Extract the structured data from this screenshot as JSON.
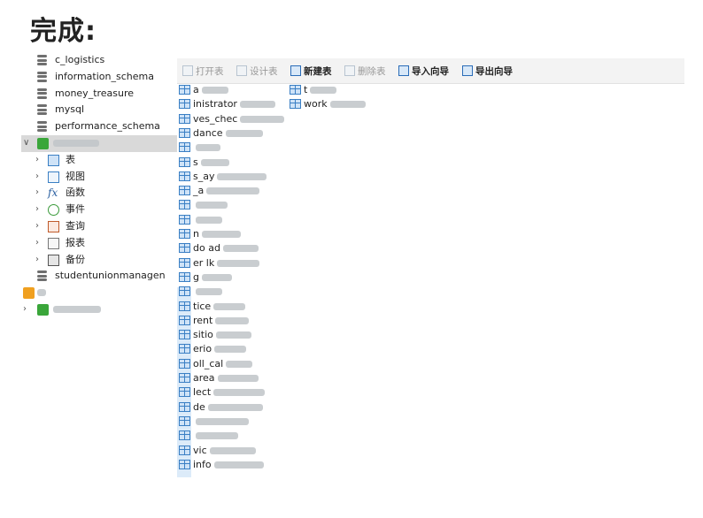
{
  "heading": "完成:",
  "sidebar": {
    "databases_above": [
      "c_logistics",
      "information_schema",
      "money_treasure",
      "mysql",
      "performance_schema"
    ],
    "children": [
      {
        "label": "表",
        "icon": "table-icon"
      },
      {
        "label": "视图",
        "icon": "view-icon"
      },
      {
        "label": "函数",
        "icon": "function-icon"
      },
      {
        "label": "事件",
        "icon": "event-icon"
      },
      {
        "label": "查询",
        "icon": "query-icon"
      },
      {
        "label": "报表",
        "icon": "report-icon"
      },
      {
        "label": "备份",
        "icon": "backup-icon"
      }
    ],
    "database_below": "studentunionmanagen"
  },
  "toolbar": {
    "open": "打开表",
    "design": "设计表",
    "new": "新建表",
    "delete": "删除表",
    "import": "导入向导",
    "export": "导出向导"
  },
  "tables_col1": [
    "a",
    "inistrator",
    "ves_chec",
    "dance",
    "",
    "s",
    "s_ay",
    "_a",
    "",
    "",
    "n",
    "do  ad",
    "er  lk",
    "g",
    "",
    "tice",
    "rent",
    "sitio",
    "erio",
    "oll_cal",
    "area",
    "lect",
    "de",
    "",
    "",
    "vic",
    "info"
  ],
  "tables_col2": [
    "t",
    "work"
  ],
  "colors": {
    "toolbar_bg": "#f3f3f3",
    "selection": "#d9d9d9",
    "table_icon": "#3a7fc4"
  }
}
